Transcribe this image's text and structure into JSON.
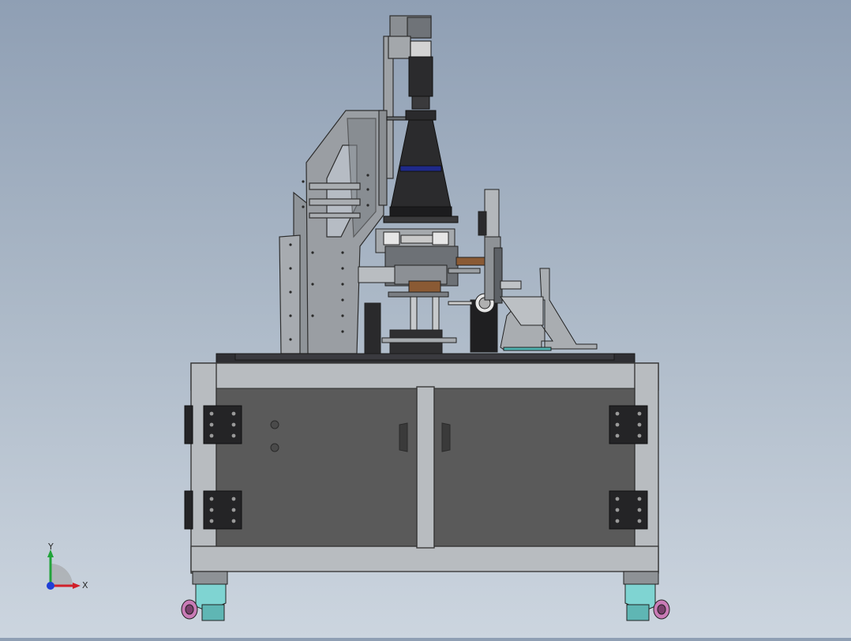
{
  "viewport": {
    "background_top": "#8f9fb4",
    "background_bottom": "#ccd5df"
  },
  "colors": {
    "frame": "#b8bcc0",
    "frame_edge": "#3a3a3a",
    "door": "#5a5a5a",
    "top_plate": "#2f2f33",
    "mount_plate": "#9a9ea3",
    "lens_dark": "#2a2a2c",
    "lens_ring": "#1f2a8a",
    "caster_teal": "#7fd4d2",
    "caster_wheel": "#c97bb6",
    "axis_x": "#d0202a",
    "axis_y": "#21a33a",
    "axis_z": "#1f3fd6"
  },
  "triad": {
    "x_label": "X",
    "y_label": "Y"
  },
  "icons": {
    "axis_triad": "coordinate-triad-icon"
  }
}
